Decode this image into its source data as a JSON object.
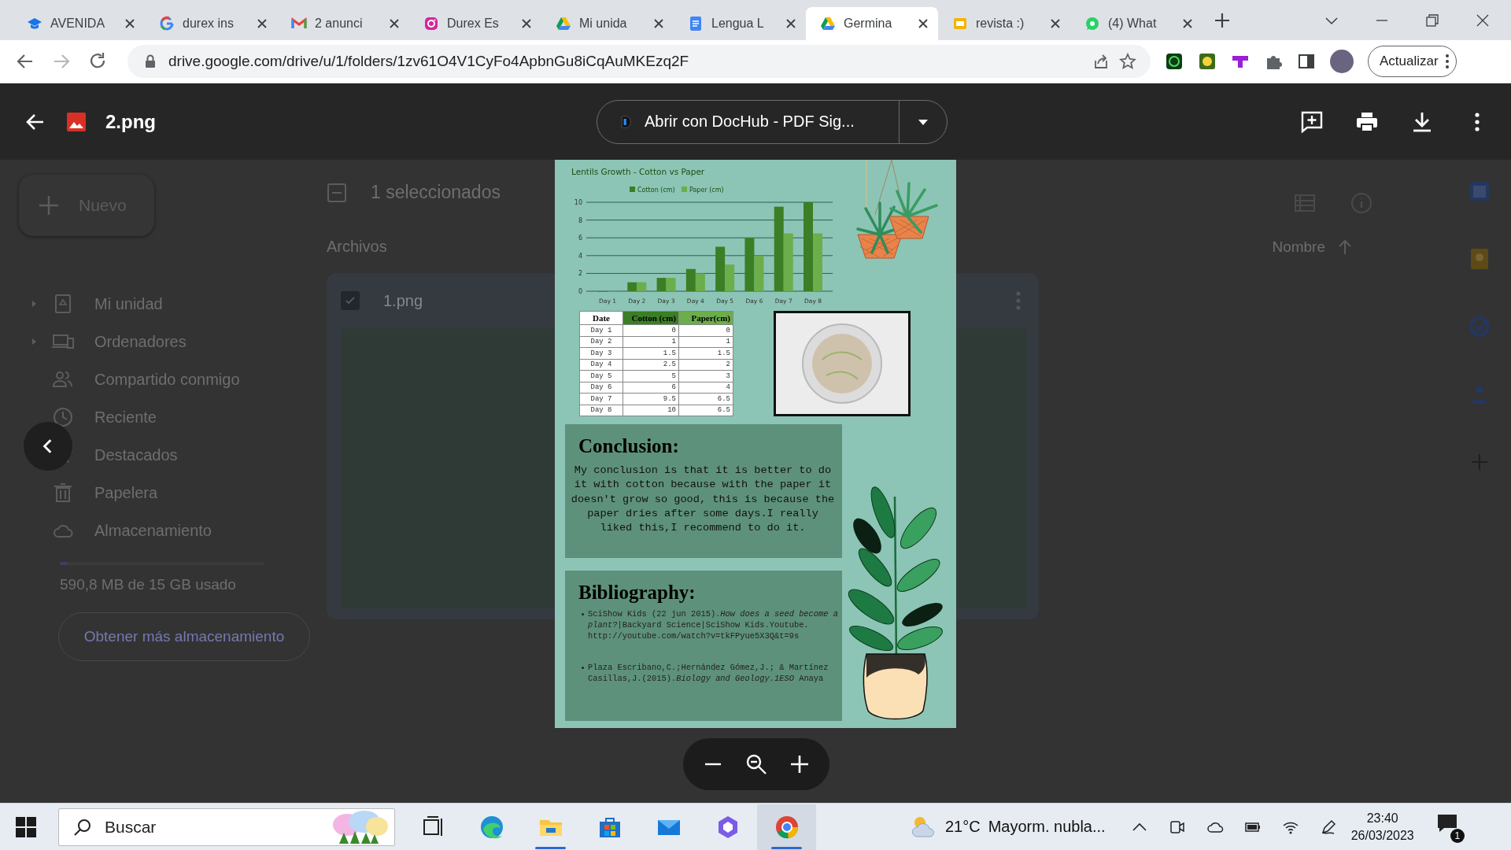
{
  "browser": {
    "tabs": [
      {
        "kind": "classroom",
        "title": "AVENIDA",
        "selected": false
      },
      {
        "kind": "google",
        "title": "durex ins",
        "selected": false
      },
      {
        "kind": "gmail",
        "title": "2 anunci",
        "selected": false
      },
      {
        "kind": "instagram",
        "title": "Durex Es",
        "selected": false
      },
      {
        "kind": "drive",
        "title": "Mi unida",
        "selected": false
      },
      {
        "kind": "docs",
        "title": "Lengua L",
        "selected": false
      },
      {
        "kind": "drive",
        "title": "Germina",
        "selected": true
      },
      {
        "kind": "slides",
        "title": "revista :)",
        "selected": false
      },
      {
        "kind": "whatsapp",
        "title": "(4) What",
        "selected": false
      }
    ],
    "url": "drive.google.com/drive/u/1/folders/1zv61O4V1CyFo4ApbnGu8iCqAuMKEzq2F",
    "update_button": "Actualizar"
  },
  "viewer": {
    "file_name": "2.png",
    "open_with": "Abrir con DocHub - PDF Sig..."
  },
  "drive": {
    "new_button": "Nuevo",
    "nav": [
      {
        "kind": "my-drive",
        "label": "Mi unidad",
        "expandable": true
      },
      {
        "kind": "computers",
        "label": "Ordenadores",
        "expandable": true
      },
      {
        "kind": "shared",
        "label": "Compartido conmigo",
        "expandable": false
      },
      {
        "kind": "recent",
        "label": "Reciente",
        "expandable": false
      },
      {
        "kind": "starred",
        "label": "Destacados"
      },
      {
        "kind": "trash",
        "label": "Papelera",
        "expandable": false
      },
      {
        "kind": "storage",
        "label": "Almacenamiento",
        "expandable": false
      }
    ],
    "storage": {
      "level": 0.04,
      "usage": "590,8 MB de 15 GB usado",
      "button": "Obtener más almacenamiento"
    },
    "selection": "1 seleccionados",
    "section": "Archivos",
    "sort": "Nombre",
    "files": [
      {
        "name": "1.png",
        "checked": true
      }
    ]
  },
  "document": {
    "chart_data": {
      "type": "bar",
      "title": "Lentils Growth - Cotton vs Paper",
      "categories": [
        "Day 1",
        "Day 2",
        "Day 3",
        "Day 4",
        "Day 5",
        "Day 6",
        "Day 7",
        "Day 8"
      ],
      "series": [
        {
          "name": "Cotton (cm)",
          "color": "#3b7e25",
          "values": [
            0,
            1,
            1.5,
            2.5,
            5,
            6,
            9.5,
            10
          ]
        },
        {
          "name": "Paper (cm)",
          "color": "#6cad4c",
          "values": [
            0,
            1,
            1.5,
            2,
            3,
            4,
            6.5,
            6.5
          ]
        }
      ],
      "ylim": [
        0,
        10
      ],
      "yticks": [
        {
          "value": 0,
          "label": "0"
        },
        {
          "value": 2,
          "label": "2"
        },
        {
          "value": 4,
          "label": "4"
        },
        {
          "value": 6,
          "label": "6"
        },
        {
          "value": 8,
          "label": "8"
        },
        {
          "value": 10,
          "label": "10"
        }
      ],
      "grid": true,
      "legend": true
    },
    "table": {
      "columns": [
        {
          "label": "Date",
          "color": "#ffffff"
        },
        {
          "label": "Cotton (cm)",
          "color": "#3b7e25"
        },
        {
          "label": "Paper(cm)",
          "color": "#6cad4c"
        }
      ],
      "rows": [
        [
          "Day 1",
          "0",
          "0"
        ],
        [
          "Day 2",
          "1",
          "1"
        ],
        [
          "Day 3",
          "1.5",
          "1.5"
        ],
        [
          "Day 4",
          "2.5",
          "2"
        ],
        [
          "Day 5",
          "5",
          "3"
        ],
        [
          "Day 6",
          "6",
          "4"
        ],
        [
          "Day 7",
          "9.5",
          "6.5"
        ],
        [
          "Day 8",
          "10",
          "6.5"
        ]
      ]
    },
    "conclusion": {
      "title": "Conclusion:",
      "text": "My conclusion is that it is better to do it with cotton because with the paper it doesn't grow so good, this is because the paper dries after some days.I really liked this,I recommend to do it."
    },
    "bibliography": {
      "title": "Bibliography:",
      "items": [
        "SciShow Kids (22 jun 2015).*How does a seed become a plant?*|Backyard Science|SciShow Kids.Youtube. http://youtube.com/watch?v=tkFPyue5X3Q&t=9s",
        "Plaza Escribano,C.;Hernández Gómez,J.; & Martínez Casillas,J.(2015).*Biology and Geology.1ESO* Anaya"
      ]
    }
  },
  "taskbar": {
    "search": "Buscar",
    "apps": [
      {
        "kind": "task-view",
        "running": false,
        "active": false
      },
      {
        "kind": "edge",
        "running": false,
        "active": false
      },
      {
        "kind": "explorer",
        "running": true,
        "active": false
      },
      {
        "kind": "store",
        "running": false,
        "active": false
      },
      {
        "kind": "mail",
        "running": false,
        "active": false
      },
      {
        "kind": "hexagon",
        "running": false,
        "active": false
      },
      {
        "kind": "chrome",
        "running": true,
        "active": true
      }
    ],
    "temperature": "21°C",
    "weather": "Mayorm. nubla...",
    "time": "23:40",
    "date": "26/03/2023",
    "notifications": "1"
  }
}
